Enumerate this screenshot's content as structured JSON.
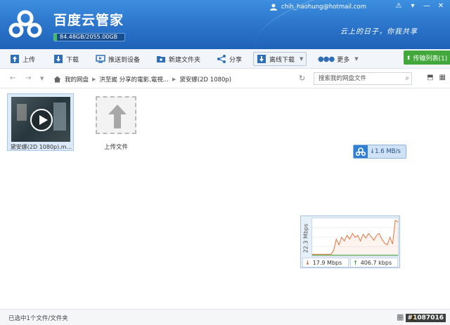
{
  "header": {
    "app_title": "百度云管家",
    "quota_text": "84.48GB/2055.00GB",
    "quota_fraction": 0.041,
    "user_email": "chih_haohung@hotmail.com",
    "slogan": "云上的日子，你我共享"
  },
  "toolbar": {
    "upload": "上传",
    "download": "下载",
    "push_device": "推送到设备",
    "new_folder": "新建文件夹",
    "share": "分享",
    "offline_download": "离线下载",
    "more": "更多",
    "transfer_list": "传输列表(1)"
  },
  "address": {
    "crumbs": [
      "我的网盘",
      "洪至崴 分享的電影,電視...",
      "黛安娜(2D 1080p)"
    ],
    "search_placeholder": "搜索我的网盘文件"
  },
  "files": [
    {
      "name": "黛安娜(2D 1080p).m..."
    }
  ],
  "upload_tile_label": "上传文件",
  "speed_badge": "1.6 MB/s",
  "graph": {
    "ylabel": "22.3 Mbps",
    "download_speed": "17.9 Mbps",
    "upload_speed": "406.7 kbps",
    "series": [
      0.05,
      0.05,
      0.05,
      0.05,
      0.05,
      0.05,
      0.05,
      0.05,
      0.15,
      0.45,
      0.3,
      0.5,
      0.4,
      0.55,
      0.45,
      0.6,
      0.5,
      0.55,
      0.4,
      0.58,
      0.48,
      0.6,
      0.52,
      0.42,
      0.55,
      0.6,
      0.45,
      0.35,
      0.3,
      0.5,
      0.32,
      0.95,
      0.9
    ]
  },
  "status": {
    "selection_text": "已选中1个文件/文件夹"
  },
  "watermark": "#1087016"
}
